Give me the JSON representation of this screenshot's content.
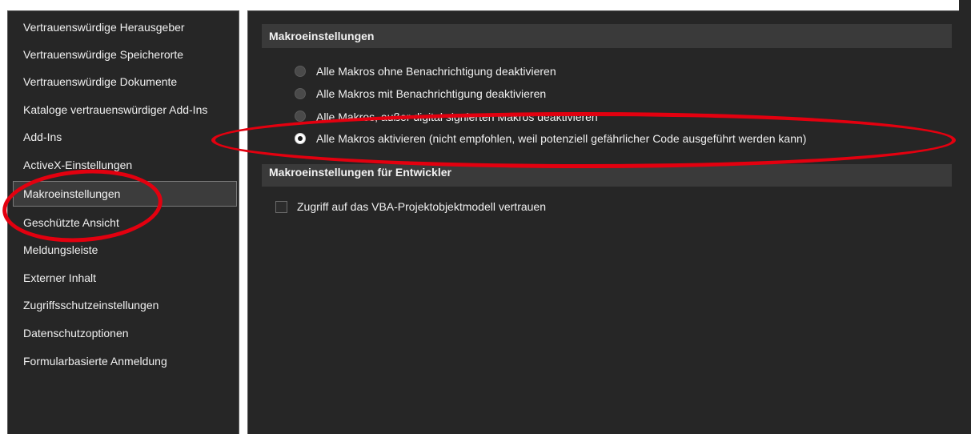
{
  "sidebar": {
    "items": [
      {
        "label": "Vertrauenswürdige Herausgeber"
      },
      {
        "label": "Vertrauenswürdige Speicherorte"
      },
      {
        "label": "Vertrauenswürdige Dokumente"
      },
      {
        "label": "Kataloge vertrauenswürdiger Add-Ins"
      },
      {
        "label": "Add-Ins"
      },
      {
        "label": "ActiveX-Einstellungen"
      },
      {
        "label": "Makroeinstellungen"
      },
      {
        "label": "Geschützte Ansicht"
      },
      {
        "label": "Meldungsleiste"
      },
      {
        "label": "Externer Inhalt"
      },
      {
        "label": "Zugriffsschutzeinstellungen"
      },
      {
        "label": "Datenschutzoptionen"
      },
      {
        "label": "Formularbasierte Anmeldung"
      }
    ],
    "selected_index": 6
  },
  "macro_settings": {
    "header": "Makroeinstellungen",
    "options": [
      {
        "label": "Alle Makros ohne Benachrichtigung deaktivieren",
        "checked": false
      },
      {
        "label": "Alle Makros mit Benachrichtigung deaktivieren",
        "checked": false
      },
      {
        "label": "Alle Makros, außer digital signierten Makros deaktivieren",
        "checked": false
      },
      {
        "label": "Alle Makros aktivieren (nicht empfohlen, weil potenziell gefährlicher Code ausgeführt werden kann)",
        "checked": true
      }
    ]
  },
  "developer_settings": {
    "header": "Makroeinstellungen für Entwickler",
    "vba_access_label": "Zugriff auf das VBA-Projektobjektmodell vertrauen",
    "vba_access_checked": false
  },
  "colors": {
    "panel_background": "#262626",
    "header_background": "#3a3a3a",
    "text": "#f0f0f0",
    "annotation": "#e3000f"
  }
}
